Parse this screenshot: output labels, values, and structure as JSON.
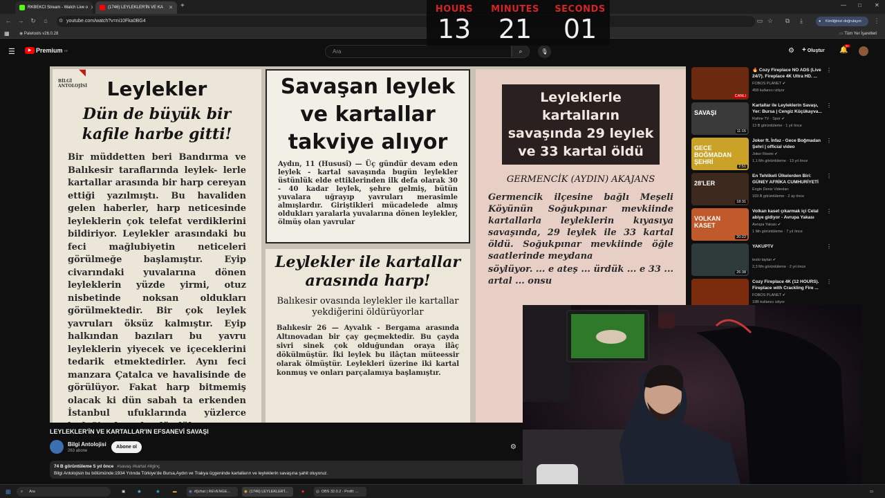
{
  "browser": {
    "tabs": [
      {
        "label": "RKBEKCI Stream - Watch Live o"
      },
      {
        "label": "(1746) LEYLEKLER'İN VE KA"
      }
    ],
    "url": "youtube.com/watch?v=ni10Fka0BG4",
    "bookmark": "Paletools v26.0.28",
    "verify_label": "Kimliğinizi doğrulayın",
    "all_bookmarks": "Tüm Yer İşaretleri"
  },
  "timer": {
    "hours_label": "HOURS",
    "minutes_label": "MINUTES",
    "seconds_label": "SECONDS",
    "hours": "13",
    "minutes": "21",
    "seconds": "01"
  },
  "youtube": {
    "logo": "Premium",
    "logo_sup": "TR",
    "search_placeholder": "Ara",
    "create_label": "Oluştur",
    "notif_badge": "9+"
  },
  "video_frame": {
    "watermark_line1": "BİLGİ",
    "watermark_line2": "ANTOLOJİSİ",
    "clip1_title": "Leylekler",
    "clip1_sub": "Dün de büyük bir kafile harbe gitti!",
    "clip1_body": "Bir müddetten beri Bandırma ve Balıkesir taraflarında leylek- lerle kartallar arasında bir harp cereyan ettiği yazılmıştı. Bu havaliden gelen haberler, harp neticesinde leyleklerin çok telefat verdiklerini bildiriyor. Leylekler arasındaki bu feci mağlubiyetin neticeleri görülmeğe başlamıştır. Eyip civarındaki yuvalarına dönen leyleklerin yüzde yirmi, otuz nisbetinde noksan oldukları görülmektedir. Bir çok leylek yavruları öksüz kalmıştır. Eyip halkından bazıları bu yavru leyleklerin yiyecek ve içeceklerini tedarik etmektedirler. Aynı feci manzara Çatalca ve havalisinde de görülüyor. Fakat harp bitmemiş olacak ki dün sabah ta erkenden İstanbul ufuklarında yüzlerce leyleğin havada döndükten sonra Marmaraya doğru sürü halinde uçup",
    "clip2_title": "Savaşan leylek ve kartallar takviye alıyor",
    "clip2_body": "Aydın, 11 (Hususî) — Üç gündür devam eden leylek - kartal savaşında bugün leylekler üstünlük elde ettiklerinden ilk defa olarak 30 - 40 kadar leylek, şehre gelmiş, bütün yuvalara uğrayıp yavruları merasimle almışlardır. Giriştikleri mücadelede almış oldukları yaralarla yuvalarına dönen leylekler, ölmüş olan yavrular",
    "clip3_title": "Leylekler ile kartallar arasında harp!",
    "clip3_sub": "Balıkesir ovasında leylekler ile kartallar yekdiğerini öldürüyorlar",
    "clip3_body": "Balıkesir 26 — Ayvalık - Bergama arasında Altınovadan bir çay geçmektedir. Bu çayda sivri sinek çok olduğundan oraya ilâç dökülmüştür. İki leylek bu ilâçtan müteessir olarak ölmüştür. Leylekleri üzerine iki kartal konmuş ve onları parçalamıya başlamıştır.",
    "clip4_title": "Leyleklerle kartalların savaşında 29 leylek ve 33 kartal öldü",
    "clip4_dateline": "GERMENCİK (AYDIN) AKAJANS",
    "clip4_body": "Germencik ilçesine bağlı Meşeli Köyünün Soğukpınar mevkiinde kartallarla leyleklerin kıyasıya savaşında, 29 leylek ile 33 kartal öldü. Soğukpınar mevkiinde öğle saatlerinde meydana",
    "clip4_edge": "söylüyor. ... e ateş ... ürdük ... e 33 ... artal ... onsu"
  },
  "video": {
    "title": "LEYLEKLER'İN VE KARTALLAR'IN EFSANEVİ SAVAŞI",
    "channel": "Bilgi Antolojisi",
    "subs": "263 abone",
    "subscribe": "Abone ol",
    "views_date": "74 B görüntüleme  5 yıl önce",
    "tags": "#savaş #kartal #ilginç",
    "description": "Bilgi Antolojisin bu bölümünde:1934 Yılında Türkiye'de Bursa,Aydın ve Trakya üçgeninde kartalların ve leyleklerin savaşına şahit oluyoruz."
  },
  "recommendations": [
    {
      "title": "🔥 Cozy Fireplace NO ADS (Live 24/7). Fireplace 4K Ultra HD. ...",
      "channel": "FOBOS PLANET ✔",
      "meta": "458 kullanıcı izliyor",
      "badge": "CANLI",
      "thumb_color": "#6b2a10"
    },
    {
      "title": "Kartallar ile Leyleklerin Savaşı, Yer: Bursa | Cengiz Küçükayva...",
      "channel": "Rafine TV · Spor ✔",
      "meta": "13 B görüntüleme · 1 yıl önce",
      "duration": "11:15",
      "thumb_text": "SAVAŞI",
      "thumb_color": "#3a3a3a"
    },
    {
      "title": "Joker ft. İnfaz - Gece Boğmadan Şehri | official video",
      "channel": "Joker Resmi ✔",
      "meta": "1,1 Mn görüntüleme · 13 yıl önce",
      "duration": "2:51",
      "thumb_text": "GECE BOĞMADAN ŞEHRİ",
      "thumb_color": "#c9a227"
    },
    {
      "title": "En Tehlikeli Ülkelerden Biri: GÜNEY AFRİKA CUMHURİYETİ",
      "channel": "Engin Deniz Videoları",
      "meta": "193 B görüntüleme · 2 ay önce",
      "duration": "18:31",
      "thumb_text": "28'LER",
      "thumb_color": "#3d2a1e"
    },
    {
      "title": "Volkan kaset çıkarmak içi Celal abiye gidiyor - Avrupa Yakası",
      "channel": "Avrupa Yakası ✔",
      "meta": "1 Mn görüntüleme · 7 yıl önce",
      "duration": "20:22",
      "thumb_text": "VOLKAN KASET",
      "thumb_color": "#c05a2a"
    },
    {
      "title": "YAKUPTV",
      "channel": "testo taylan ✔",
      "meta": "2,3 Mn görüntüleme · 2 yıl önce",
      "duration": "26:38",
      "thumb_color": "#2f3a3a"
    },
    {
      "title": "Cozy Fireplace 4K (12 HOURS). Fireplace with Crackling Fire ...",
      "channel": "FOBOS PLANET ✔",
      "meta": "19B kullanıcı izliyor",
      "thumb_color": "#7a2c0c"
    }
  ],
  "taskbar": {
    "search": "Ara",
    "apps": [
      "#||chat | REVENGE...",
      "(1746) LEYLEKLER'İ...",
      "OBS 32.0.2 - Profil: ..."
    ]
  }
}
